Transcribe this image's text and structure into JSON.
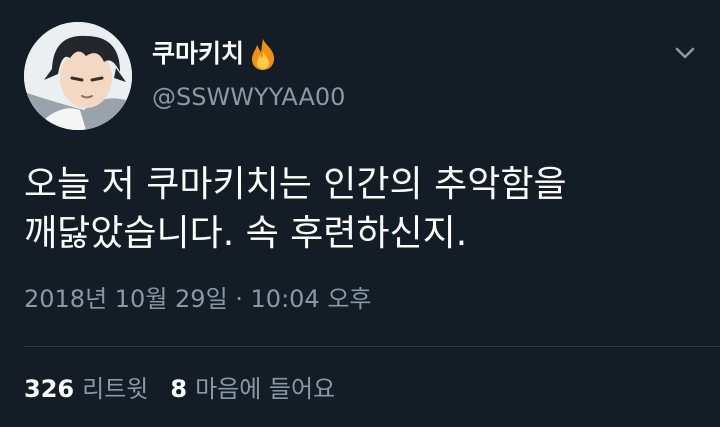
{
  "author": {
    "display_name": "쿠마키치",
    "handle": "@SSWWYYAA00",
    "avatar_icon": "anime-character-avatar",
    "badge_icon": "fire-emoji"
  },
  "tweet": {
    "lines": [
      "오늘 저 쿠마키치는 인간의 추악함을",
      "깨닳았습니다. 속 후련하신지."
    ],
    "timestamp": "2018년 10월 29일 · 10:04 오후"
  },
  "stats": {
    "retweets": {
      "count": "326",
      "label": "리트윗"
    },
    "likes": {
      "count": "8",
      "label": "마음에 들어요"
    }
  },
  "colors": {
    "background": "#141d26",
    "secondary_text": "#8899a6",
    "divider": "#2f3b47"
  }
}
